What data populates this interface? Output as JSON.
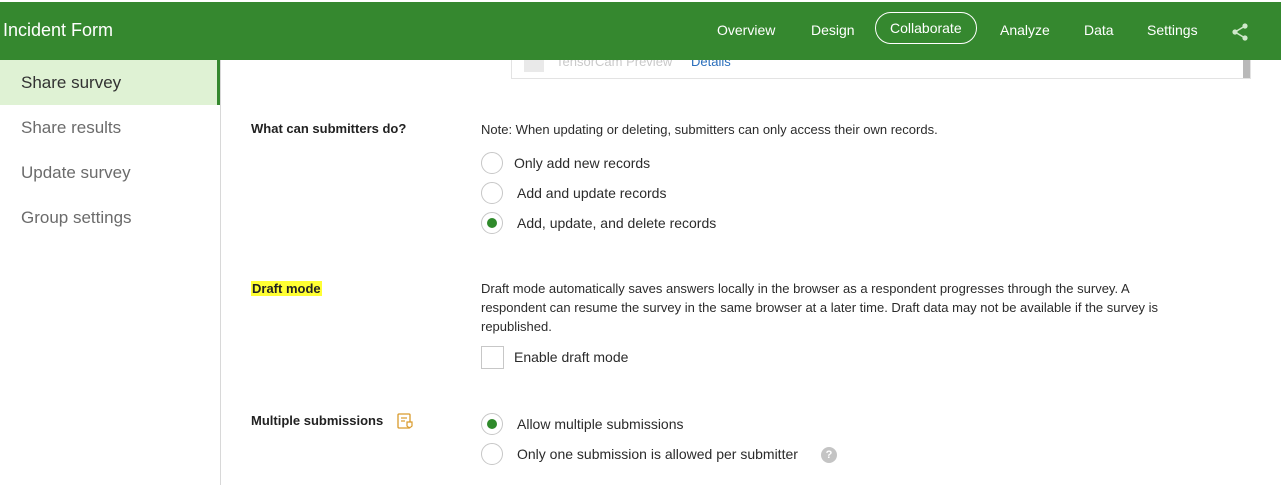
{
  "header": {
    "title": "Incident Form",
    "nav": {
      "overview": "Overview",
      "design": "Design",
      "collaborate": "Collaborate",
      "analyze": "Analyze",
      "data": "Data",
      "settings": "Settings"
    },
    "active_nav": "Collaborate",
    "share_icon": "share-icon",
    "brand_color": "#35882f"
  },
  "sidebar": {
    "items": [
      {
        "label": "Share survey",
        "active": true
      },
      {
        "label": "Share results",
        "active": false
      },
      {
        "label": "Update survey",
        "active": false
      },
      {
        "label": "Group settings",
        "active": false
      }
    ]
  },
  "preview": {
    "text": "TensorCam Preview",
    "link": "Details"
  },
  "submitters": {
    "label": "What can submitters do?",
    "note": "Note: When updating or deleting, submitters can only access their own records.",
    "options": [
      {
        "label": "Only add new records",
        "checked": false
      },
      {
        "label": "Add and update records",
        "checked": false
      },
      {
        "label": "Add, update, and delete records",
        "checked": true
      }
    ]
  },
  "draft": {
    "label": "Draft mode",
    "description_line1": "Draft mode automatically saves answers locally in the browser as a respondent progresses through the survey. A",
    "description_line2": "respondent can resume the survey in the same browser at a later time. Draft data may not be available if the survey is",
    "description_line3": "republished.",
    "checkbox_label": "Enable draft mode",
    "checked": false
  },
  "multiple": {
    "label": "Multiple submissions",
    "icon": "form-settings-icon",
    "options": [
      {
        "label": "Allow multiple submissions",
        "checked": true
      },
      {
        "label": "Only one submission is allowed per submitter",
        "checked": false
      }
    ],
    "help_icon": "help-icon"
  }
}
